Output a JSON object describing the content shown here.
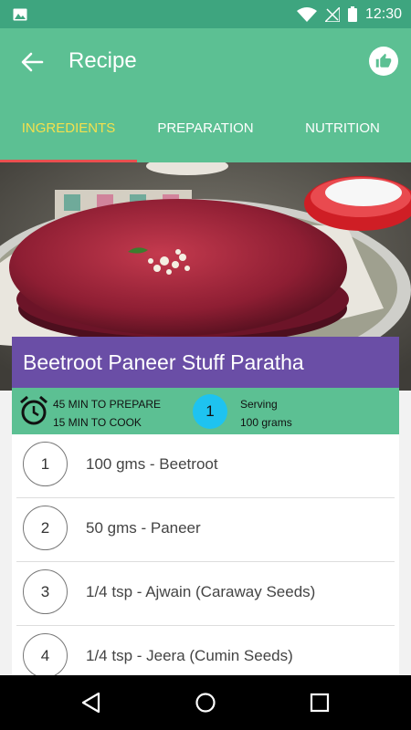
{
  "status_bar": {
    "time": "12:30",
    "icons": [
      "image-icon",
      "wifi-icon",
      "no-signal-icon",
      "battery-icon"
    ],
    "color": "#3ea57f"
  },
  "app_bar": {
    "title": "Recipe",
    "back_icon": "arrow-back-icon",
    "action_icon": "thumbs-up-icon",
    "color": "#5cc093"
  },
  "tabs": [
    {
      "label": "INGREDIENTS",
      "active": true
    },
    {
      "label": "PREPARATION",
      "active": false
    },
    {
      "label": "NUTRITION",
      "active": false
    }
  ],
  "recipe": {
    "title": "Beetroot Paneer Stuff Paratha",
    "prepare_time": "45 MIN TO PREPARE",
    "cook_time": "15 MIN TO COOK",
    "servings": "1",
    "serving_label": "Serving",
    "serving_size": "100 grams"
  },
  "ingredients": [
    {
      "number": "1",
      "text": "100 gms - Beetroot"
    },
    {
      "number": "2",
      "text": "50 gms - Paneer"
    },
    {
      "number": "3",
      "text": "1/4 tsp - Ajwain (Caraway Seeds)"
    },
    {
      "number": "4",
      "text": "1/4 tsp - Jeera (Cumin Seeds)"
    }
  ],
  "colors": {
    "accent": "#6a4ea6",
    "active_tab": "#f4e04d",
    "tab_indicator": "#e94f4f",
    "serving_badge": "#1ec3f0"
  },
  "nav_bar": {
    "icons": [
      "nav-back-icon",
      "nav-home-icon",
      "nav-recents-icon"
    ]
  }
}
